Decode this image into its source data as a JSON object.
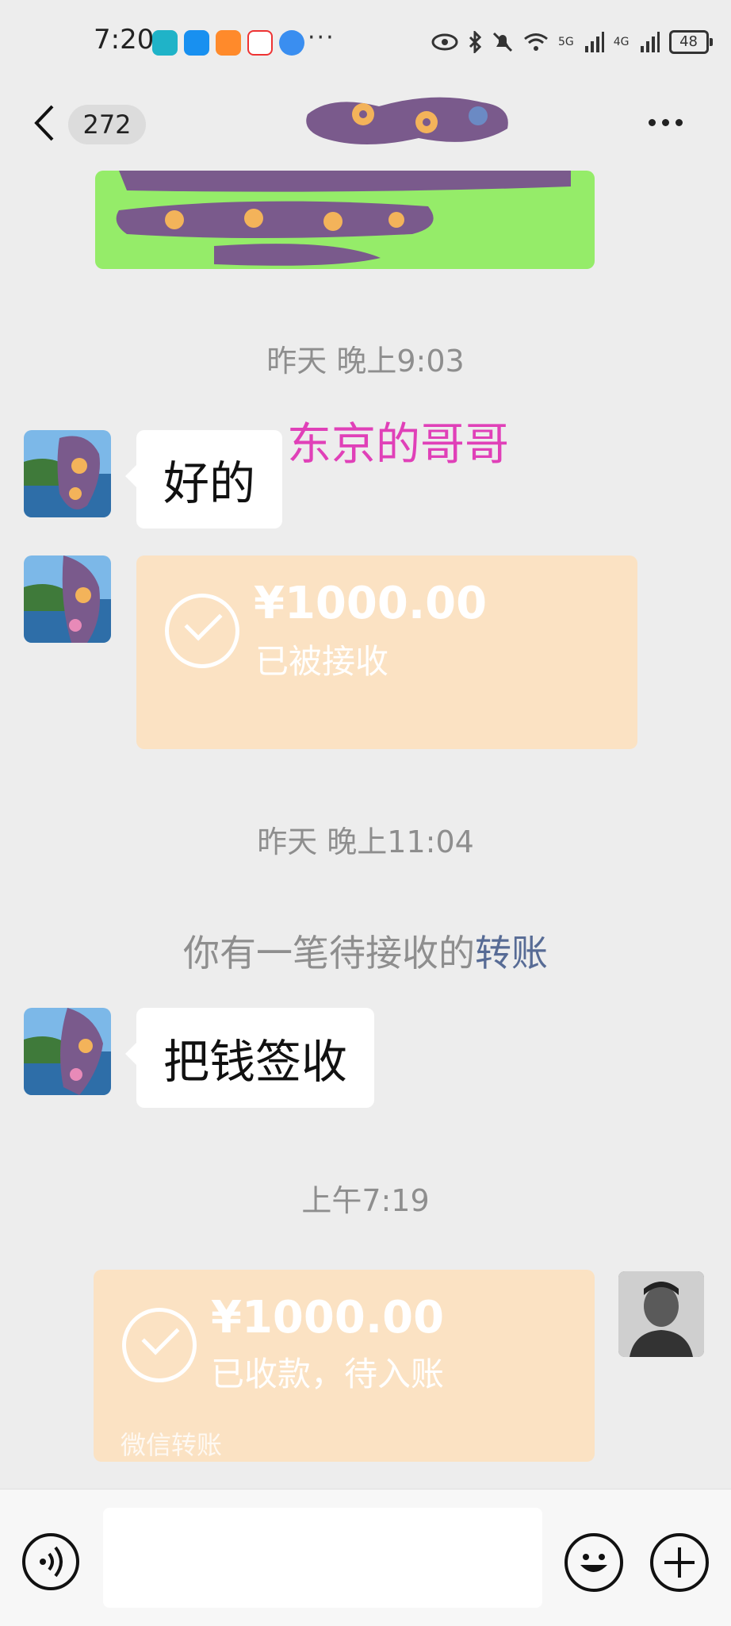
{
  "status_bar": {
    "time": "7:20",
    "more": "···",
    "battery": "48",
    "signal_left": "5G",
    "signal_right": "4G"
  },
  "header": {
    "unread_count": "272"
  },
  "messages": {
    "ts1": "昨天 晚上9:03",
    "sender_name": "东京的哥哥",
    "msg1": "好的",
    "transfer1": {
      "amount": "¥1000.00",
      "status": "已被接收"
    },
    "ts2": "昨天 晚上11:04",
    "notice_text": "你有一笔待接收的",
    "notice_link": "转账",
    "msg2": "把钱签收",
    "ts3": "上午7:19",
    "transfer2": {
      "amount": "¥1000.00",
      "status": "已收款，待入账",
      "footer": "微信转账"
    }
  },
  "colors": {
    "self_bubble": "#95ec69",
    "transfer_bg": "#fbe2c3",
    "name_label": "#e040b8",
    "link": "#576b95"
  },
  "icons": [
    "back-icon",
    "more-icon",
    "voice-icon",
    "emoji-icon",
    "plus-icon",
    "check-icon",
    "eye-icon",
    "bluetooth-icon",
    "mute-icon",
    "wifi-icon",
    "battery-icon"
  ]
}
